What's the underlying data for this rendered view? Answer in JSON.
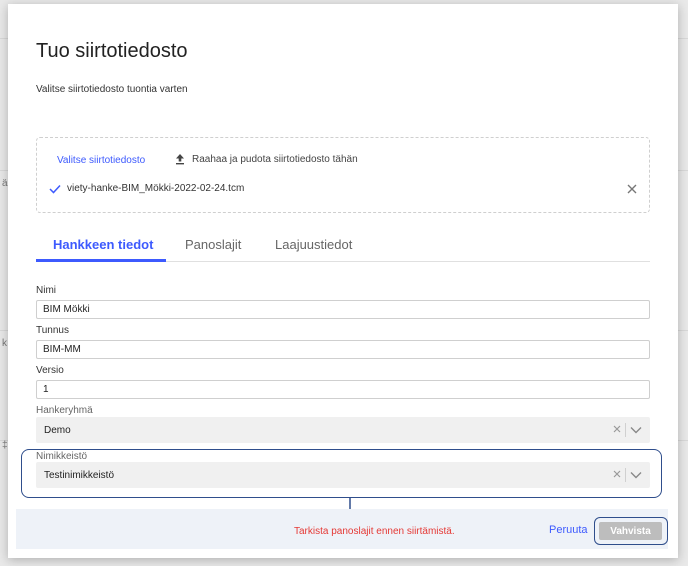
{
  "background_fragments": [
    "ä",
    "k",
    "‡"
  ],
  "dialog": {
    "title": "Tuo siirtotiedosto",
    "subtitle": "Valitse siirtotiedosto tuontia varten"
  },
  "upload": {
    "pick_label": "Valitse siirtotiedosto",
    "drag_label": "Raahaa ja pudota siirtotiedosto tähän",
    "file_name": "viety-hanke-BIM_Mökki-2022-02-24.tcm"
  },
  "tabs": [
    {
      "label": "Hankkeen tiedot",
      "active": true
    },
    {
      "label": "Panoslajit",
      "active": false
    },
    {
      "label": "Laajuustiedot",
      "active": false
    }
  ],
  "fields": {
    "nimi": {
      "label": "Nimi",
      "value": "BIM Mökki"
    },
    "tunnus": {
      "label": "Tunnus",
      "value": "BIM-MM"
    },
    "versio": {
      "label": "Versio",
      "value": "1"
    },
    "hankeryhma": {
      "label": "Hankeryhmä",
      "value": "Demo"
    },
    "nimikkeisto": {
      "label": "Nimikkeistö",
      "value": "Testinimikkeistö"
    }
  },
  "footer": {
    "warning": "Tarkista panoslajit ennen siirtämistä.",
    "cancel_label": "Peruuta",
    "confirm_label": "Vahvista"
  },
  "colors": {
    "accent": "#3d5afe",
    "warning": "#e53935",
    "highlight": "#2f4e8c",
    "disabled": "#bdbdbd"
  }
}
